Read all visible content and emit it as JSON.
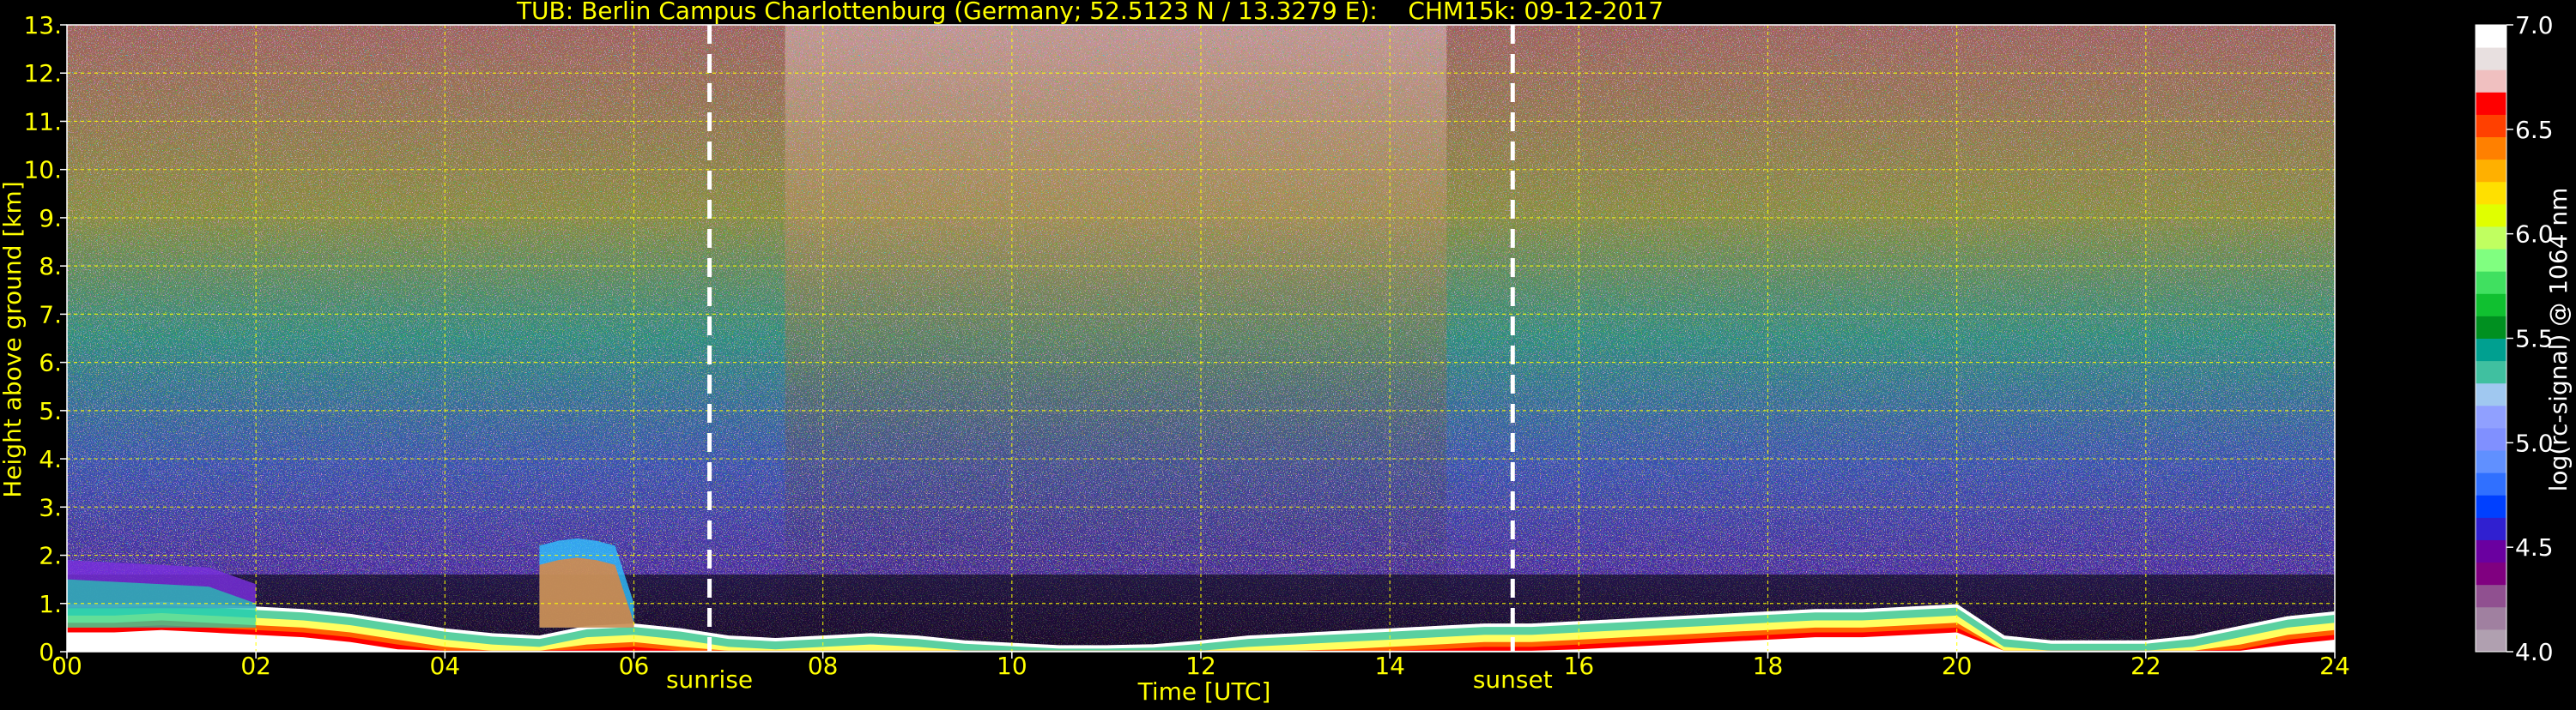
{
  "chart_data": {
    "type": "heatmap",
    "title": "TUB: Berlin Campus Charlottenburg (Germany; 52.5123 N / 13.3279 E):    CHM15k: 09-12-2017",
    "xlabel": "Time [UTC]",
    "ylabel": "Height above ground [km]",
    "xlim": [
      0,
      24
    ],
    "ylim": [
      0,
      13
    ],
    "x_ticks": [
      0,
      2,
      4,
      6,
      8,
      10,
      12,
      14,
      16,
      18,
      20,
      22,
      24
    ],
    "x_tick_labels": [
      "00",
      "02",
      "04",
      "06",
      "08",
      "10",
      "12",
      "14",
      "16",
      "18",
      "20",
      "22",
      "24"
    ],
    "y_ticks": [
      0,
      1,
      2,
      3,
      4,
      5,
      6,
      7,
      8,
      9,
      10,
      11,
      12,
      13
    ],
    "y_tick_labels": [
      "0.",
      "1.",
      "2.",
      "3.",
      "4.",
      "5.",
      "6.",
      "7.",
      "8.",
      "9.",
      "10.",
      "11.",
      "12.",
      "13."
    ],
    "grid": true,
    "markers": [
      {
        "label": "sunrise",
        "x": 6.8
      },
      {
        "label": "sunset",
        "x": 15.3
      }
    ],
    "colorbar": {
      "label": "log(rc-signal) @ 1064 nm",
      "range": [
        4.0,
        7.0
      ],
      "ticks": [
        4.0,
        4.5,
        5.0,
        5.5,
        6.0,
        6.5,
        7.0
      ],
      "tick_labels": [
        "4.0",
        "4.5",
        "5.0",
        "5.5",
        "6.0",
        "6.5",
        "7.0"
      ],
      "colors": [
        "#b0a0b0",
        "#a080a0",
        "#905090",
        "#800080",
        "#6a00a0",
        "#3020d0",
        "#0040ff",
        "#3070ff",
        "#6090ff",
        "#8090ff",
        "#90a0ff",
        "#a0c8f0",
        "#40c0a0",
        "#00a090",
        "#009020",
        "#10c030",
        "#40e060",
        "#80ff80",
        "#c0ff60",
        "#e0ff00",
        "#ffe000",
        "#ffb000",
        "#ff8000",
        "#ff4000",
        "#ff0000",
        "#f0c0c0",
        "#e8e0e0",
        "#ffffff"
      ]
    },
    "layers": [
      {
        "name": "boundary layer top",
        "x": [
          0,
          0.5,
          1,
          1.5,
          2,
          2.5,
          3,
          3.5,
          4,
          4.5,
          5,
          5.5,
          6,
          6.5,
          7,
          7.5,
          8,
          8.5,
          9,
          9.5,
          10,
          10.5,
          11,
          11.5,
          12,
          12.5,
          13,
          13.5,
          14,
          14.5,
          15,
          15.5,
          16,
          16.5,
          17,
          17.5,
          18,
          18.5,
          19,
          19.5,
          20,
          20.5,
          21,
          21.5,
          22,
          22.5,
          23,
          23.5,
          24
        ],
        "y": [
          0.95,
          0.95,
          1.0,
          0.95,
          0.9,
          0.85,
          0.75,
          0.6,
          0.45,
          0.35,
          0.3,
          0.5,
          0.55,
          0.45,
          0.3,
          0.25,
          0.3,
          0.35,
          0.3,
          0.2,
          0.15,
          0.1,
          0.1,
          0.12,
          0.2,
          0.3,
          0.35,
          0.4,
          0.45,
          0.5,
          0.55,
          0.55,
          0.6,
          0.65,
          0.7,
          0.75,
          0.8,
          0.85,
          0.85,
          0.9,
          0.95,
          0.3,
          0.2,
          0.2,
          0.2,
          0.3,
          0.5,
          0.7,
          0.8
        ]
      },
      {
        "name": "residual layer top",
        "x": [
          0,
          0.5,
          1,
          1.5,
          2
        ],
        "y": [
          1.9,
          1.85,
          1.8,
          1.75,
          1.4
        ]
      },
      {
        "name": "convective plume",
        "x": [
          5.0,
          5.2,
          5.4,
          5.6,
          5.8,
          6.0
        ],
        "y": [
          2.2,
          2.3,
          2.35,
          2.3,
          2.2,
          1.0
        ]
      }
    ]
  }
}
